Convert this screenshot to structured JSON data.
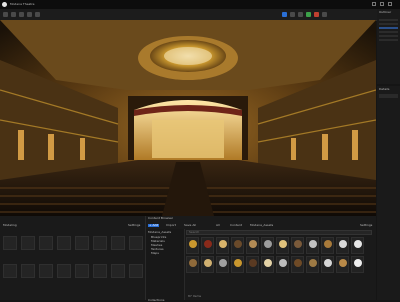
{
  "window": {
    "title": "Modena Theatre"
  },
  "toolbar": {
    "icons": [
      "save-icon",
      "mode-icon",
      "content-icon",
      "blueprint-icon",
      "cinematics-icon",
      "play-icon",
      "pause-icon",
      "stop-icon",
      "settings-icon"
    ]
  },
  "outliner": {
    "label": "Outliner"
  },
  "details": {
    "label": "Details"
  },
  "left_panel": {
    "tab": "Modeling",
    "settings_label": "Settings"
  },
  "content": {
    "tab": "Content Browser",
    "add_label": "+ Add",
    "import_label": "Import",
    "save_all_label": "Save All",
    "breadcrumb": [
      "All",
      "Content",
      "Modena_Assets"
    ],
    "settings_label": "Settings",
    "search_placeholder": "Search",
    "tree_root": "Modena_Assets",
    "tree_items": [
      "Blueprints",
      "Materials",
      "Meshes",
      "Textures",
      "Maps"
    ],
    "collections_label": "Collections",
    "status": "87 items"
  },
  "colors": {
    "accent": "#2a6fd6",
    "gold": "#c9972e",
    "panel": "#1a1a1a"
  }
}
